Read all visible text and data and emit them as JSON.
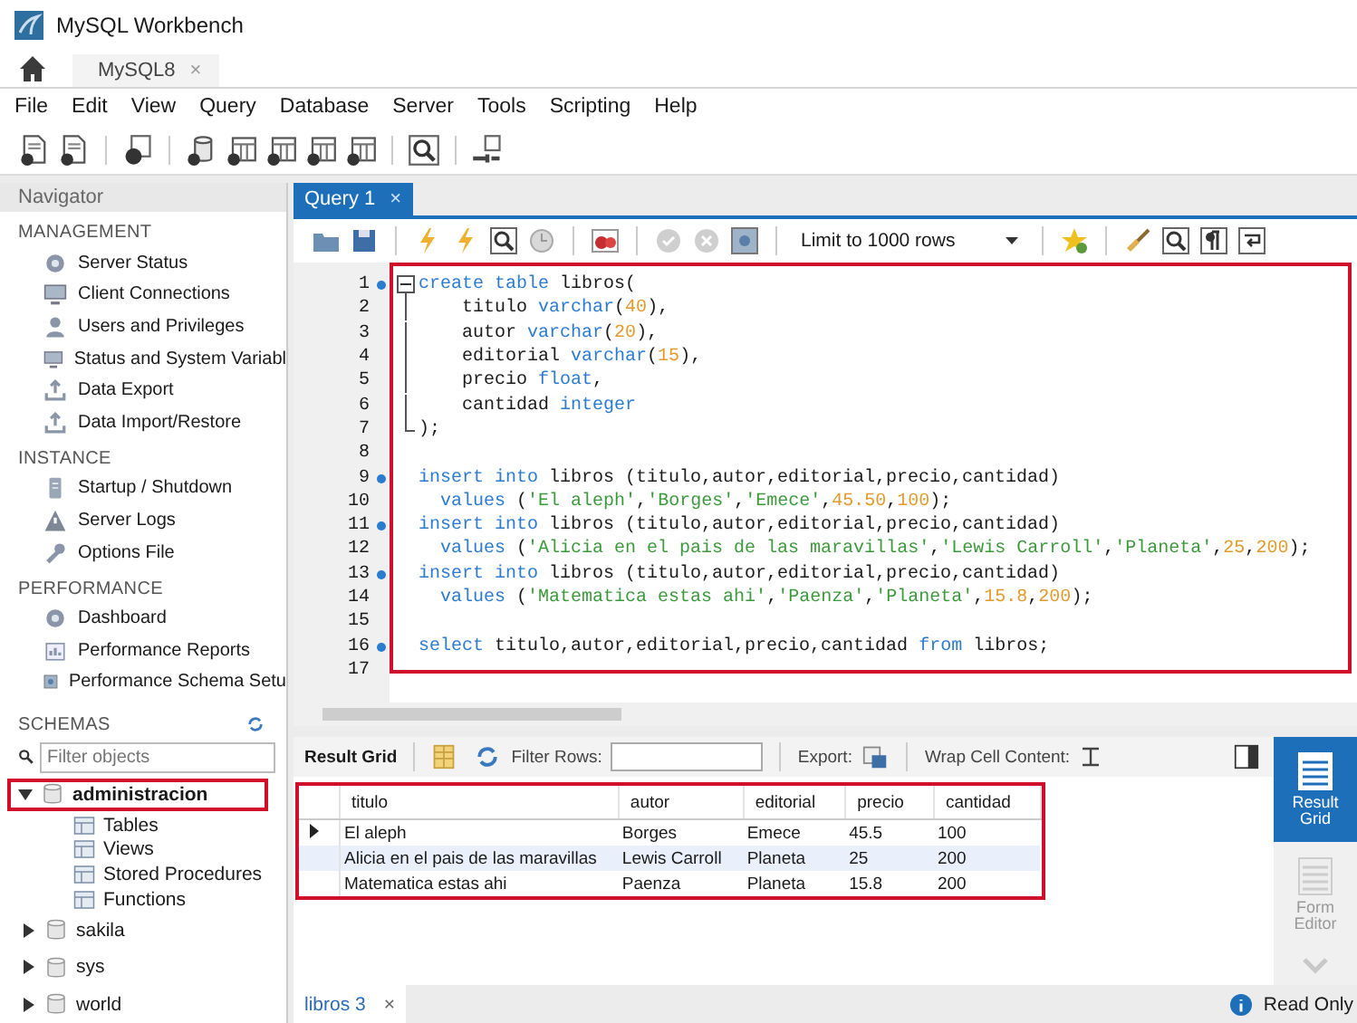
{
  "window": {
    "title": "MySQL Workbench"
  },
  "connection_tabs": [
    {
      "label": "MySQL8",
      "close": "×",
      "selected": true
    }
  ],
  "menu": [
    "File",
    "Edit",
    "View",
    "Query",
    "Database",
    "Server",
    "Tools",
    "Scripting",
    "Help"
  ],
  "navigator": {
    "title": "Navigator",
    "sections": [
      {
        "title": "MANAGEMENT",
        "items": [
          "Server Status",
          "Client Connections",
          "Users and Privileges",
          "Status and System Variabl",
          "Data Export",
          "Data Import/Restore"
        ]
      },
      {
        "title": "INSTANCE",
        "items": [
          "Startup / Shutdown",
          "Server Logs",
          "Options File"
        ]
      },
      {
        "title": "PERFORMANCE",
        "items": [
          "Dashboard",
          "Performance Reports",
          "Performance Schema Setu"
        ]
      }
    ]
  },
  "schemas": {
    "title": "SCHEMAS",
    "placeholder": "Filter objects",
    "tree": [
      {
        "label": "administracion",
        "expanded": true,
        "selected": true,
        "highlighted": true,
        "children": [
          {
            "label": "Tables"
          },
          {
            "label": "Views"
          },
          {
            "label": "Stored Procedures"
          },
          {
            "label": "Functions"
          }
        ]
      },
      {
        "label": "sakila",
        "expanded": false,
        "selected": false,
        "highlighted": false
      },
      {
        "label": "sys",
        "expanded": false,
        "selected": false,
        "highlighted": false
      },
      {
        "label": "world",
        "expanded": false,
        "selected": false,
        "highlighted": false
      }
    ]
  },
  "query_tabs": [
    {
      "label": "Query 1",
      "close": "×",
      "selected": true
    }
  ],
  "limit_select": {
    "value": "Limit to 1000 rows"
  },
  "editor": {
    "highlighted": true,
    "lines": [
      {
        "number": "1",
        "marker": true,
        "fold_open": true,
        "fold_inner": false,
        "fold_end": false,
        "tokens": [
          {
            "color": "#2b7bd0",
            "t": "create table"
          },
          {
            "color": "#1a1a1a",
            "t": " libros("
          }
        ]
      },
      {
        "number": "2",
        "marker": false,
        "fold_open": false,
        "fold_inner": true,
        "fold_end": false,
        "tokens": [
          {
            "color": "#1a1a1a",
            "t": "    titulo "
          },
          {
            "color": "#2b7bd0",
            "t": "varchar"
          },
          {
            "color": "#1a1a1a",
            "t": "("
          },
          {
            "color": "#e49a2c",
            "t": "40"
          },
          {
            "color": "#1a1a1a",
            "t": "),"
          }
        ]
      },
      {
        "number": "3",
        "marker": false,
        "fold_open": false,
        "fold_inner": true,
        "fold_end": false,
        "tokens": [
          {
            "color": "#1a1a1a",
            "t": "    autor "
          },
          {
            "color": "#2b7bd0",
            "t": "varchar"
          },
          {
            "color": "#1a1a1a",
            "t": "("
          },
          {
            "color": "#e49a2c",
            "t": "20"
          },
          {
            "color": "#1a1a1a",
            "t": "),"
          }
        ]
      },
      {
        "number": "4",
        "marker": false,
        "fold_open": false,
        "fold_inner": true,
        "fold_end": false,
        "tokens": [
          {
            "color": "#1a1a1a",
            "t": "    editorial "
          },
          {
            "color": "#2b7bd0",
            "t": "varchar"
          },
          {
            "color": "#1a1a1a",
            "t": "("
          },
          {
            "color": "#e49a2c",
            "t": "15"
          },
          {
            "color": "#1a1a1a",
            "t": "),"
          }
        ]
      },
      {
        "number": "5",
        "marker": false,
        "fold_open": false,
        "fold_inner": true,
        "fold_end": false,
        "tokens": [
          {
            "color": "#1a1a1a",
            "t": "    precio "
          },
          {
            "color": "#2b7bd0",
            "t": "float"
          },
          {
            "color": "#1a1a1a",
            "t": ","
          }
        ]
      },
      {
        "number": "6",
        "marker": false,
        "fold_open": false,
        "fold_inner": true,
        "fold_end": false,
        "tokens": [
          {
            "color": "#1a1a1a",
            "t": "    cantidad "
          },
          {
            "color": "#2b7bd0",
            "t": "integer"
          }
        ]
      },
      {
        "number": "7",
        "marker": false,
        "fold_open": false,
        "fold_inner": false,
        "fold_end": true,
        "tokens": [
          {
            "color": "#1a1a1a",
            "t": ");"
          }
        ]
      },
      {
        "number": "8",
        "marker": false,
        "fold_open": false,
        "fold_inner": false,
        "fold_end": false
      },
      {
        "number": "9",
        "marker": true,
        "fold_open": false,
        "fold_inner": false,
        "fold_end": false,
        "tokens": [
          {
            "color": "#2b7bd0",
            "t": "insert into"
          },
          {
            "color": "#1a1a1a",
            "t": " libros (titulo,autor,editorial,precio,cantidad)"
          }
        ]
      },
      {
        "number": "10",
        "marker": false,
        "fold_open": false,
        "fold_inner": false,
        "fold_end": false,
        "tokens": [
          {
            "color": "#2b7bd0",
            "t": "  values"
          },
          {
            "color": "#1a1a1a",
            "t": " ("
          },
          {
            "color": "#3c9a3c",
            "t": "'El aleph'"
          },
          {
            "color": "#1a1a1a",
            "t": ","
          },
          {
            "color": "#3c9a3c",
            "t": "'Borges'"
          },
          {
            "color": "#1a1a1a",
            "t": ","
          },
          {
            "color": "#3c9a3c",
            "t": "'Emece'"
          },
          {
            "color": "#1a1a1a",
            "t": ","
          },
          {
            "color": "#e49a2c",
            "t": "45.50"
          },
          {
            "color": "#1a1a1a",
            "t": ","
          },
          {
            "color": "#e49a2c",
            "t": "100"
          },
          {
            "color": "#1a1a1a",
            "t": ");"
          }
        ]
      },
      {
        "number": "11",
        "marker": true,
        "fold_open": false,
        "fold_inner": false,
        "fold_end": false,
        "tokens": [
          {
            "color": "#2b7bd0",
            "t": "insert into"
          },
          {
            "color": "#1a1a1a",
            "t": " libros (titulo,autor,editorial,precio,cantidad)"
          }
        ]
      },
      {
        "number": "12",
        "marker": false,
        "fold_open": false,
        "fold_inner": false,
        "fold_end": false,
        "tokens": [
          {
            "color": "#2b7bd0",
            "t": "  values"
          },
          {
            "color": "#1a1a1a",
            "t": " ("
          },
          {
            "color": "#3c9a3c",
            "t": "'Alicia en el pais de las maravillas'"
          },
          {
            "color": "#1a1a1a",
            "t": ","
          },
          {
            "color": "#3c9a3c",
            "t": "'Lewis Carroll'"
          },
          {
            "color": "#1a1a1a",
            "t": ","
          },
          {
            "color": "#3c9a3c",
            "t": "'Planeta'"
          },
          {
            "color": "#1a1a1a",
            "t": ","
          },
          {
            "color": "#e49a2c",
            "t": "25"
          },
          {
            "color": "#1a1a1a",
            "t": ","
          },
          {
            "color": "#e49a2c",
            "t": "200"
          },
          {
            "color": "#1a1a1a",
            "t": ");"
          }
        ]
      },
      {
        "number": "13",
        "marker": true,
        "fold_open": false,
        "fold_inner": false,
        "fold_end": false,
        "tokens": [
          {
            "color": "#2b7bd0",
            "t": "insert into"
          },
          {
            "color": "#1a1a1a",
            "t": " libros (titulo,autor,editorial,precio,cantidad)"
          }
        ]
      },
      {
        "number": "14",
        "marker": false,
        "fold_open": false,
        "fold_inner": false,
        "fold_end": false,
        "tokens": [
          {
            "color": "#2b7bd0",
            "t": "  values"
          },
          {
            "color": "#1a1a1a",
            "t": " ("
          },
          {
            "color": "#3c9a3c",
            "t": "'Matematica estas ahi'"
          },
          {
            "color": "#1a1a1a",
            "t": ","
          },
          {
            "color": "#3c9a3c",
            "t": "'Paenza'"
          },
          {
            "color": "#1a1a1a",
            "t": ","
          },
          {
            "color": "#3c9a3c",
            "t": "'Planeta'"
          },
          {
            "color": "#1a1a1a",
            "t": ","
          },
          {
            "color": "#e49a2c",
            "t": "15.8"
          },
          {
            "color": "#1a1a1a",
            "t": ","
          },
          {
            "color": "#e49a2c",
            "t": "200"
          },
          {
            "color": "#1a1a1a",
            "t": ");"
          }
        ]
      },
      {
        "number": "15",
        "marker": false,
        "fold_open": false,
        "fold_inner": false,
        "fold_end": false
      },
      {
        "number": "16",
        "marker": true,
        "fold_open": false,
        "fold_inner": false,
        "fold_end": false,
        "tokens": [
          {
            "color": "#2b7bd0",
            "t": "select"
          },
          {
            "color": "#1a1a1a",
            "t": " titulo,autor,editorial,precio,cantidad "
          },
          {
            "color": "#2b7bd0",
            "t": "from"
          },
          {
            "color": "#1a1a1a",
            "t": " libros;"
          }
        ]
      },
      {
        "number": "17",
        "marker": false,
        "fold_open": false,
        "fold_inner": false,
        "fold_end": false
      }
    ]
  },
  "result_toolbar": {
    "title": "Result Grid",
    "filter_label": "Filter Rows:",
    "export_label": "Export:",
    "wrap_label": "Wrap Cell Content:"
  },
  "result_grid": {
    "highlighted": true,
    "columns": [
      "titulo",
      "autor",
      "editorial",
      "precio",
      "cantidad"
    ],
    "rows": [
      {
        "current": true,
        "selected": false,
        "cells": [
          "El aleph",
          "Borges",
          "Emece",
          "45.5",
          "100"
        ]
      },
      {
        "current": false,
        "selected": true,
        "cells": [
          "Alicia en el pais de las maravillas",
          "Lewis Carroll",
          "Planeta",
          "25",
          "200"
        ]
      },
      {
        "current": false,
        "selected": false,
        "cells": [
          "Matematica estas ahi",
          "Paenza",
          "Planeta",
          "15.8",
          "200"
        ]
      }
    ]
  },
  "side_tabs": [
    {
      "label": "Result Grid",
      "selected": true
    },
    {
      "label": "Form Editor",
      "selected": false
    }
  ],
  "result_tabs": [
    {
      "label": "libros 3",
      "close": "×"
    }
  ],
  "status": "Read Only"
}
